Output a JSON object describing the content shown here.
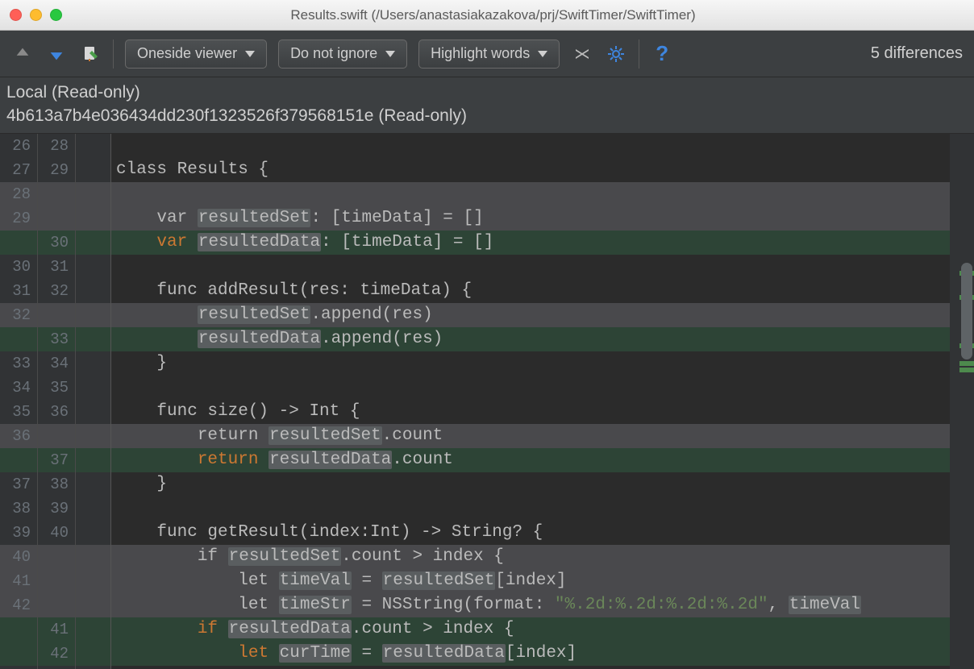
{
  "window": {
    "title": "Results.swift (/Users/anastasiakazakova/prj/SwiftTimer/SwiftTimer)"
  },
  "toolbar": {
    "viewer": "Oneside viewer",
    "ignore": "Do not ignore",
    "highlight": "Highlight words",
    "diff_count": "5 differences"
  },
  "subheader": {
    "local": "Local (Read-only)",
    "hash": "4b613a7b4e036434dd230f1323526f379568151e (Read-only)"
  },
  "lines": [
    {
      "l": "26",
      "r": "28",
      "cls": "",
      "html": ""
    },
    {
      "l": "27",
      "r": "29",
      "cls": "",
      "html": "class Results {"
    },
    {
      "l": "28",
      "r": "",
      "cls": "grey",
      "html": ""
    },
    {
      "l": "29",
      "r": "",
      "cls": "grey",
      "html": "    var <span class='hl'>resultedSet</span>: [timeData] = []"
    },
    {
      "l": "",
      "r": "30",
      "cls": "green",
      "html": "    <span class='kw'>var</span> <span class='hl'>resultedData</span>: [timeData] = []"
    },
    {
      "l": "30",
      "r": "31",
      "cls": "",
      "html": ""
    },
    {
      "l": "31",
      "r": "32",
      "cls": "",
      "html": "    func addResult(res: timeData) {"
    },
    {
      "l": "32",
      "r": "",
      "cls": "grey",
      "html": "        <span class='hl'>resultedSet</span>.append(res)"
    },
    {
      "l": "",
      "r": "33",
      "cls": "green",
      "html": "        <span class='hl'>resultedData</span>.append(res)"
    },
    {
      "l": "33",
      "r": "34",
      "cls": "",
      "html": "    }"
    },
    {
      "l": "34",
      "r": "35",
      "cls": "",
      "html": ""
    },
    {
      "l": "35",
      "r": "36",
      "cls": "",
      "html": "    func size() -> Int {"
    },
    {
      "l": "36",
      "r": "",
      "cls": "grey",
      "html": "        return <span class='hl'>resultedSet</span>.count"
    },
    {
      "l": "",
      "r": "37",
      "cls": "green",
      "html": "        <span class='kw'>return</span> <span class='hl'>resultedData</span>.count"
    },
    {
      "l": "37",
      "r": "38",
      "cls": "",
      "html": "    }"
    },
    {
      "l": "38",
      "r": "39",
      "cls": "",
      "html": ""
    },
    {
      "l": "39",
      "r": "40",
      "cls": "",
      "html": "    func getResult(index:Int) -> String? {"
    },
    {
      "l": "40",
      "r": "",
      "cls": "grey",
      "html": "        if <span class='hl'>resultedSet</span>.count > index {"
    },
    {
      "l": "41",
      "r": "",
      "cls": "grey",
      "html": "            let <span class='hl'>timeVal</span> = <span class='hl'>resultedSet</span>[index]"
    },
    {
      "l": "42",
      "r": "",
      "cls": "grey",
      "html": "            let <span class='hl'>timeStr</span> = NSString(format: <span class='str'>\"%.2d:%.2d:%.2d:%.2d\"</span>, <span class='hl'>timeVal</span>"
    },
    {
      "l": "",
      "r": "41",
      "cls": "green",
      "html": "        <span class='kw'>if</span> <span class='hl'>resultedData</span>.count > index {"
    },
    {
      "l": "",
      "r": "42",
      "cls": "green",
      "html": "            <span class='kw'>let</span> <span class='hl'>curTime</span> = <span class='hl'>resultedData</span>[index]"
    }
  ]
}
